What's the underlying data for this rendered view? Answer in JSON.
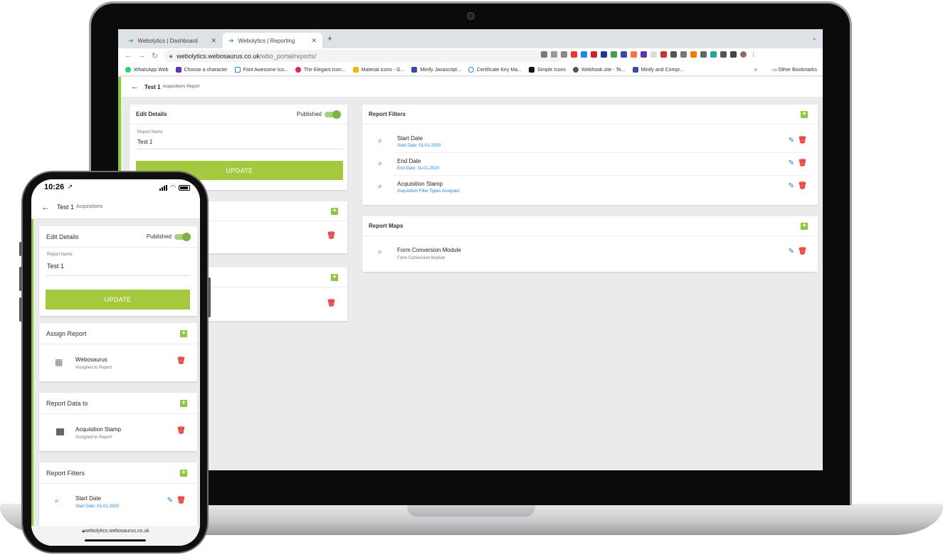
{
  "browser": {
    "tabs": [
      {
        "title": "Webolytics | Dashboard",
        "active": false
      },
      {
        "title": "Webolytics | Reporting",
        "active": true
      }
    ],
    "url_host": "webolytics.webosaurus.co.uk",
    "url_path": "/wbo_portal/reports/",
    "bookmarks": [
      "WhatsApp Web",
      "Choose a character",
      "Font Awesome Ico...",
      "The Elegant Icon...",
      "Material icons - G...",
      "Minify Javascript...",
      "Certificate Key Ma...",
      "Simple Icons",
      "Webhook.site - Te...",
      "Minify and Compr..."
    ],
    "other_bookmarks": "Other Bookmarks"
  },
  "page": {
    "title": "Test 1",
    "subtitle": "Acquisitions Report",
    "edit_details": {
      "header": "Edit Details",
      "published_label": "Published",
      "report_name_label": "Report Name",
      "report_name_value": "Test 1",
      "update_label": "UPDATE"
    },
    "report_filters": {
      "header": "Report Filters",
      "items": [
        {
          "title": "Start Date",
          "subtitle": "Start Date: 01-01-2020"
        },
        {
          "title": "End Date",
          "subtitle": "End Date: 31-01-2020"
        },
        {
          "title": "Acquisition Stamp",
          "subtitle": "Acquisition Filter Types Assigned"
        }
      ]
    },
    "report_maps": {
      "header": "Report Maps",
      "items": [
        {
          "title": "Form Conversion Module",
          "subtitle": "Form Conversion Module"
        }
      ]
    }
  },
  "phone": {
    "time": "10:26",
    "title": "Test 1",
    "subtitle": "Acquisitions",
    "edit_details": {
      "header": "Edit Details",
      "published_label": "Published",
      "report_name_label": "Report Name",
      "report_name_value": "Test 1",
      "update_label": "UPDATE"
    },
    "assign_report": {
      "header": "Assign Report",
      "item_title": "Webosaurus",
      "item_subtitle": "Assigned to Report"
    },
    "report_data_to": {
      "header": "Report Data to",
      "item_title": "Acquisition Stamp",
      "item_subtitle": "Assigned to Report"
    },
    "report_filters": {
      "header": "Report Filters",
      "item_title": "Start Date",
      "item_subtitle": "Start Date: 01-01-2020"
    },
    "url": "webolytics.webosaurus.co.uk"
  },
  "icons": {
    "back": "arrow-left-icon",
    "add": "plus-square-icon",
    "delete": "trash-icon",
    "edit": "pencil-icon",
    "search": "magnifier-icon"
  },
  "colors": {
    "accent_green": "#8dc63f",
    "update_button": "#a4c93e",
    "delete_red": "#e53935",
    "edit_blue": "#1976d2",
    "link_blue": "#1e88e5"
  }
}
